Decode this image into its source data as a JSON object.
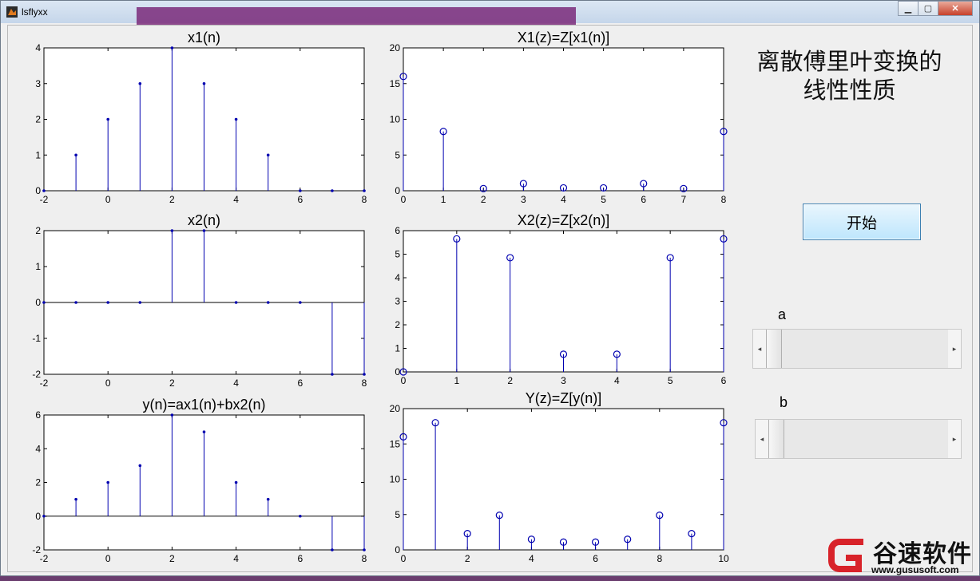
{
  "window": {
    "title": "lsflyxx"
  },
  "heading": "离散傅里叶变换的\n线性性质",
  "start_button": "开始",
  "slider_a": {
    "label": "a",
    "value": 0
  },
  "slider_b": {
    "label": "b",
    "value": 0
  },
  "logo": {
    "text": "谷速软件",
    "url": "www.gususoft.com"
  },
  "chart_data": [
    {
      "id": "x1",
      "type": "stem",
      "title": "x1(n)",
      "xlim": [
        -2,
        8
      ],
      "ylim": [
        0,
        4
      ],
      "xticks": [
        -2,
        0,
        2,
        4,
        6,
        8
      ],
      "yticks": [
        0,
        1,
        2,
        3,
        4
      ],
      "marker": "dot",
      "x": [
        -2,
        -1,
        0,
        1,
        2,
        3,
        4,
        5,
        6,
        7,
        8
      ],
      "y": [
        0,
        1,
        2,
        3,
        4,
        3,
        2,
        1,
        0,
        0,
        0
      ]
    },
    {
      "id": "X1",
      "type": "stem",
      "title": "X1(z)=Z[x1(n)]",
      "xlim": [
        0,
        8
      ],
      "ylim": [
        0,
        20
      ],
      "xticks": [
        0,
        1,
        2,
        3,
        4,
        5,
        6,
        7,
        8
      ],
      "yticks": [
        0,
        5,
        10,
        15,
        20
      ],
      "marker": "circle",
      "x": [
        0,
        1,
        2,
        3,
        4,
        5,
        6,
        7,
        8
      ],
      "y": [
        16,
        8.3,
        0.3,
        1,
        0.4,
        0.4,
        1,
        0.3,
        8.3
      ]
    },
    {
      "id": "x2",
      "type": "stem",
      "title": "x2(n)",
      "xlim": [
        -2,
        8
      ],
      "ylim": [
        -2,
        2
      ],
      "xticks": [
        -2,
        0,
        2,
        4,
        6,
        8
      ],
      "yticks": [
        -2,
        -1,
        0,
        1,
        2
      ],
      "marker": "dot",
      "zero_line": true,
      "x": [
        -2,
        -1,
        0,
        1,
        2,
        3,
        4,
        5,
        6,
        7,
        8
      ],
      "y": [
        0,
        0,
        0,
        0,
        2,
        2,
        0,
        0,
        0,
        -2,
        -2
      ]
    },
    {
      "id": "X2",
      "type": "stem",
      "title": "X2(z)=Z[x2(n)]",
      "xlim": [
        0,
        6
      ],
      "ylim": [
        0,
        6
      ],
      "xticks": [
        0,
        1,
        2,
        3,
        4,
        5,
        6
      ],
      "yticks": [
        0,
        1,
        2,
        3,
        4,
        5,
        6
      ],
      "marker": "circle",
      "x": [
        0,
        1,
        2,
        3,
        4,
        5,
        6
      ],
      "y": [
        0,
        5.65,
        4.85,
        0.75,
        0.75,
        4.85,
        5.65
      ]
    },
    {
      "id": "y",
      "type": "stem",
      "title": "y(n)=ax1(n)+bx2(n)",
      "xlim": [
        -2,
        8
      ],
      "ylim": [
        -2,
        6
      ],
      "xticks": [
        -2,
        0,
        2,
        4,
        6,
        8
      ],
      "yticks": [
        -2,
        0,
        2,
        4,
        6
      ],
      "marker": "dot",
      "zero_line": true,
      "x": [
        -2,
        -1,
        0,
        1,
        2,
        3,
        4,
        5,
        6,
        7,
        8
      ],
      "y": [
        0,
        1,
        2,
        3,
        6,
        5,
        2,
        1,
        0,
        -2,
        -2
      ]
    },
    {
      "id": "Y",
      "type": "stem",
      "title": "Y(z)=Z[y(n)]",
      "xlim": [
        0,
        10
      ],
      "ylim": [
        0,
        20
      ],
      "xticks": [
        0,
        2,
        4,
        6,
        8,
        10
      ],
      "yticks": [
        0,
        5,
        10,
        15,
        20
      ],
      "marker": "circle",
      "x": [
        0,
        1,
        2,
        3,
        4,
        5,
        6,
        7,
        8,
        9,
        10
      ],
      "y": [
        16,
        18,
        2.3,
        4.9,
        1.5,
        1.1,
        1.1,
        1.5,
        4.9,
        2.3,
        18
      ]
    }
  ]
}
